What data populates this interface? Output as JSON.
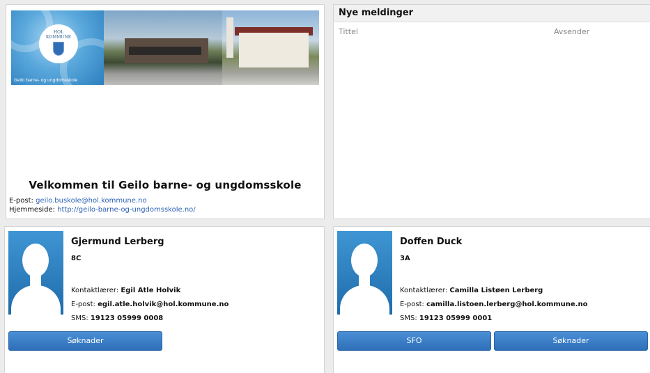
{
  "school": {
    "banner_logo_text": [
      "HOL",
      "KOMMUNE"
    ],
    "banner_caption": "Geilo barne- og ungdomsskole",
    "welcome": "Velkommen til Geilo barne- og ungdomsskole",
    "email_label": "E-post:",
    "email": "geilo.buskole@hol.kommune.no",
    "website_label": "Hjemmeside:",
    "website": "http://geilo-barne-og-ungdomsskole.no/"
  },
  "messages": {
    "title": "Nye meldinger",
    "columns": [
      "Tittel",
      "Avsender"
    ]
  },
  "students": [
    {
      "name": "Gjermund Lerberg",
      "class": "8C",
      "teacher_label": "Kontaktlærer:",
      "teacher": "Egil Atle Holvik",
      "email_label": "E-post:",
      "email": "egil.atle.holvik@hol.kommune.no",
      "sms_label": "SMS:",
      "sms": "19123 05999 0008",
      "buttons": [
        "Søknader"
      ]
    },
    {
      "name": "Doffen Duck",
      "class": "3A",
      "teacher_label": "Kontaktlærer:",
      "teacher": "Camilla Listøen Lerberg",
      "email_label": "E-post:",
      "email": "camilla.listoen.lerberg@hol.kommune.no",
      "sms_label": "SMS:",
      "sms": "19123 05999 0001",
      "buttons": [
        "SFO",
        "Søknader"
      ]
    }
  ],
  "colors": {
    "button": "#3a7fc8",
    "link": "#2e62b5",
    "avatar_bg": "#2a7dbf"
  }
}
